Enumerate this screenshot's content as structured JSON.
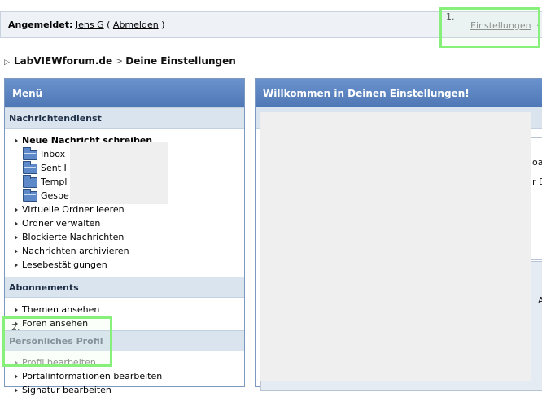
{
  "header": {
    "logged_in_label": "Angemeldet:",
    "username": "Jens G",
    "open_paren": "(",
    "logout_label": "Abmelden",
    "close_paren": ")",
    "settings_label": "Einstellungen",
    "settings_trailing": "·"
  },
  "annotations": {
    "step1": "1.",
    "step2": "2."
  },
  "breadcrumb": {
    "site": "LabVIEWforum.de",
    "separator": ">",
    "current": "Deine Einstellungen"
  },
  "menu": {
    "title": "Menü",
    "sections": {
      "messaging": {
        "title": "Nachrichtendienst",
        "compose": "Neue Nachricht schreiben",
        "folders": [
          "Inbox",
          "Sent I",
          "Templ",
          "Gespe"
        ],
        "links": [
          "Virtuelle Ordner leeren",
          "Ordner verwalten",
          "Blockierte Nachrichten",
          "Nachrichten archivieren",
          "Lesebestätigungen"
        ]
      },
      "subscriptions": {
        "title": "Abonnements",
        "links": [
          "Themen ansehen",
          "Foren ansehen"
        ]
      },
      "profile": {
        "title": "Persönliches Profil",
        "links": [
          "Profil bearbeiten",
          "Portalinformationen bearbeiten",
          "Signatur bearbeiten"
        ]
      }
    }
  },
  "main": {
    "title": "Willkommen in Deinen Einstellungen!",
    "fragments": [
      "oa",
      "r D",
      "A"
    ]
  },
  "colors": {
    "header_blue": "#5b84c2",
    "section_bg": "#d9e4ef",
    "highlight": "#87f07a"
  }
}
